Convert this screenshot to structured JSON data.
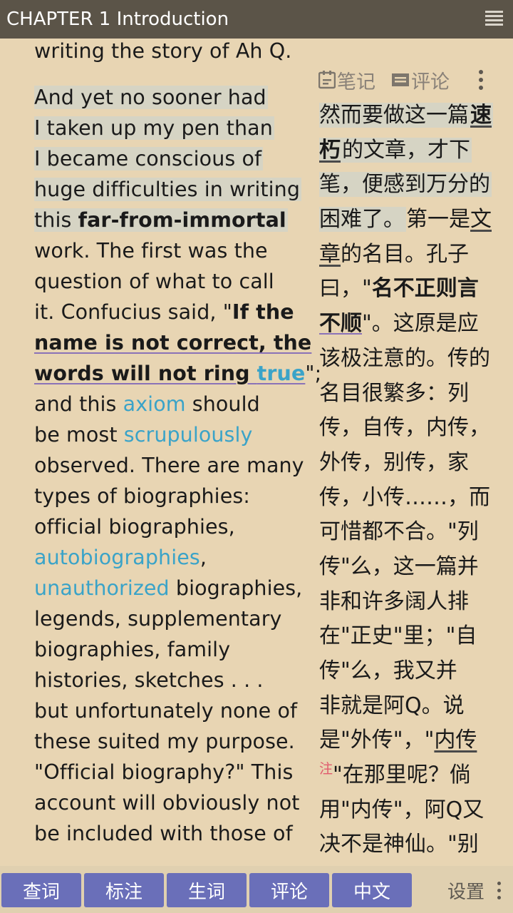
{
  "header": {
    "title": "CHAPTER 1 Introduction",
    "menu_icon": "hamburger-menu-icon"
  },
  "english": {
    "line0": "writing the story of Ah Q.",
    "p1": {
      "l1": "And yet no sooner had",
      "l2": "I taken up my pen than",
      "l3": "I became conscious of",
      "l4": "huge difficulties in writing",
      "l5a": "this ",
      "l5b": "far-from-immortal",
      "l6": "work. The first was the",
      "l7": "question of what to call",
      "l8a": "it. Confucius said, \"",
      "l8b": "If the",
      "l9": "name is not correct, the",
      "l10a": "words will not ring ",
      "l10b": "true",
      "l10c": "\";",
      "l11a": "and this ",
      "l11b": "axiom",
      "l11c": " should",
      "l12a": "be most ",
      "l12b": "scrupulously",
      "l13": "observed. There are many",
      "l14": "types of biographies:",
      "l15": "official biographies,",
      "l16a": "autobiographies",
      "l16b": ",",
      "l17a": "unauthorized",
      "l17b": " biographies,",
      "l18": "legends, supplementary",
      "l19": "biographies, family",
      "l20": "histories, sketches . . .",
      "l21": "but unfortunately none of",
      "l22": "these suited my purpose.",
      "l23": "\"Official biography?\" This",
      "l24": "account will obviously not",
      "l25": "be included with those of"
    }
  },
  "chinese_tools": {
    "notes_label": "笔记",
    "notes_icon": "notebook-icon",
    "comments_label": "评论",
    "comments_icon": "comment-icon",
    "more_icon": "more-vertical-icon"
  },
  "chinese": {
    "l1a": "然而要做这一篇",
    "l1b": "速",
    "l2a": "朽",
    "l2b": "的文章，才下",
    "l3": "笔，便感到万分的",
    "l4a": "困难了。",
    "l4b": "第一是",
    "l4c": "文",
    "l5a": "章",
    "l5b": "的名目。孔子",
    "l6a": "曰，\"",
    "l6b": "名不正则言",
    "l7a": "不顺",
    "l7b": "\"。这原是应",
    "l8": "该极注意的。传的",
    "l9": "名目很繁多：列",
    "l10": "传，自传，内传，",
    "l11": "外传，别传，家",
    "l12": "传，小传……，而",
    "l13": "可惜都不合。\"列",
    "l14": "传\"么，这一篇并",
    "l15": "非和许多阔人排",
    "l16": "在\"正史\"里；\"自",
    "l17": "传\"么，我又并",
    "l18": "非就是阿Q。说",
    "l19a": "是\"外传\"，\"",
    "l19b": "内传",
    "l20a": "注",
    "l20b": "\"在那里呢？倘",
    "l21": "用\"内传\"，阿Q又",
    "l22": "决不是神仙。\"别"
  },
  "bottom": {
    "buttons": [
      "查词",
      "标注",
      "生词",
      "评论",
      "中文"
    ],
    "settings_label": "设置",
    "settings_icon": "more-vertical-icon"
  },
  "colors": {
    "background": "#e8d5b3",
    "topbar": "#5b5448",
    "highlight": "#d6d4c4",
    "link": "#3aa3c8",
    "button": "#6a6fb9",
    "note": "#e05a6d"
  }
}
